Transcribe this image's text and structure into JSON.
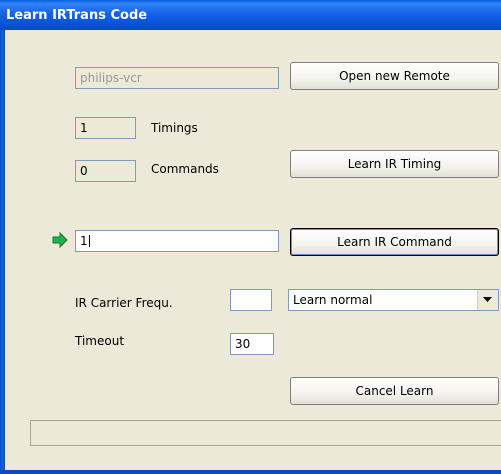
{
  "window": {
    "title": "Learn IRTrans Code"
  },
  "remote": {
    "name": "philips-vcr",
    "open_button": "Open new Remote"
  },
  "timings": {
    "count": "1",
    "label": "Timings"
  },
  "commands": {
    "count": "0",
    "label": "Commands"
  },
  "learn_timing_button": "Learn IR Timing",
  "command": {
    "value": "1",
    "learn_button": "Learn IR Command",
    "arrow_icon": "green-arrow-icon",
    "arrow_color": "#22B14C"
  },
  "carrier": {
    "label": "IR Carrier Frequ.",
    "value": "",
    "mode_selected": "Learn normal"
  },
  "timeout": {
    "label": "Timeout",
    "value": "30"
  },
  "cancel_button": "Cancel Learn",
  "status_bar": {
    "text": ""
  },
  "colors": {
    "titlebar": "#0A5FE0",
    "dialog_bg": "#ECE9D8",
    "field_border": "#7F9DB9"
  }
}
